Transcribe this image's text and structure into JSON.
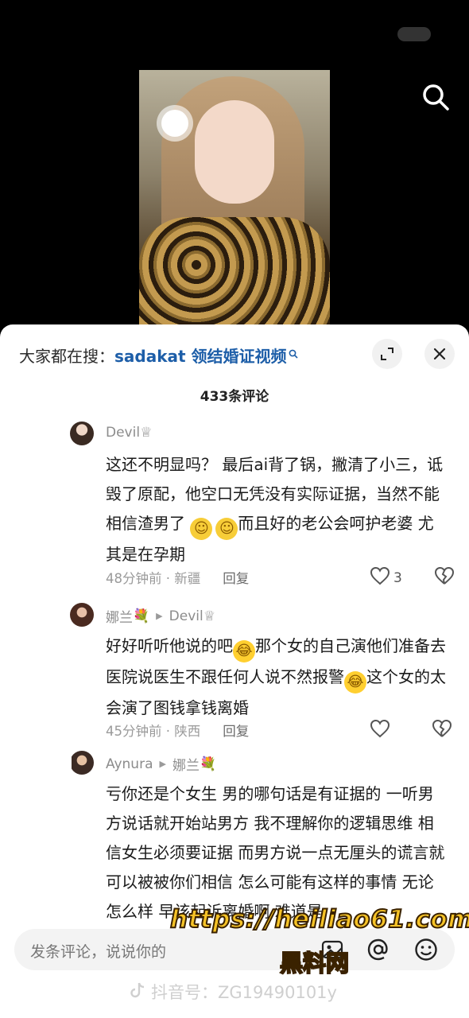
{
  "video": {
    "icon": "search-icon"
  },
  "panel": {
    "hot_search_prefix": "大家都在搜：",
    "hot_search_query": "sadakat 领结婚证视频",
    "comment_count_label": "433条评论",
    "expand_icon": "expand-icon",
    "close_icon": "close-icon"
  },
  "comments": [
    {
      "user": "Devil",
      "user_suffix": "♕",
      "text_1": "这还不明显吗？ 最后ai背了锅，撇清了小三，诋毁了原配，他空口无凭没有实际证据，当然不能相信渣男了",
      "text_2": "而且好的老公会呵护老婆 尤其是在孕期",
      "meta": "48分钟前 · 新疆",
      "reply": "回复",
      "likes": "3"
    },
    {
      "user": "娜兰",
      "user_suffix": "💐",
      "reply_to": "Devil",
      "reply_to_suffix": "♕",
      "text_1": "好好听听他说的吧",
      "text_2": "那个女的自己演他们准备去医院说医生不跟任何人说不然报警",
      "text_3": "这个女的太会演了图钱拿钱离婚",
      "meta": "45分钟前 · 陕西",
      "reply": "回复",
      "likes": ""
    },
    {
      "user": "Aynura",
      "reply_to": "娜兰",
      "reply_to_suffix": "💐",
      "text_1": "亏你还是个女生 男的哪句话是有证据的 一听男方说话就开始站男方 我不理解你的逻辑思维 相信女生必须要证据 而男方说一点无厘头的谎言就可以被被你们相信 怎么可能有这样的事情 无论怎么样 早该起诉离婚啊 难道是"
    }
  ],
  "bottom": {
    "input_placeholder": "发条评论，说说你的",
    "image_icon": "image-icon",
    "mention_icon": "at-mention-icon",
    "emoji_icon": "emoji-icon",
    "douyin_label": "抖音号：ZG19490101y"
  },
  "watermark": {
    "url": "https://heiliao61.com",
    "site_name": "黑料网"
  },
  "colors": {
    "link": "#1d5ea8",
    "watermark": "#f6c327"
  }
}
